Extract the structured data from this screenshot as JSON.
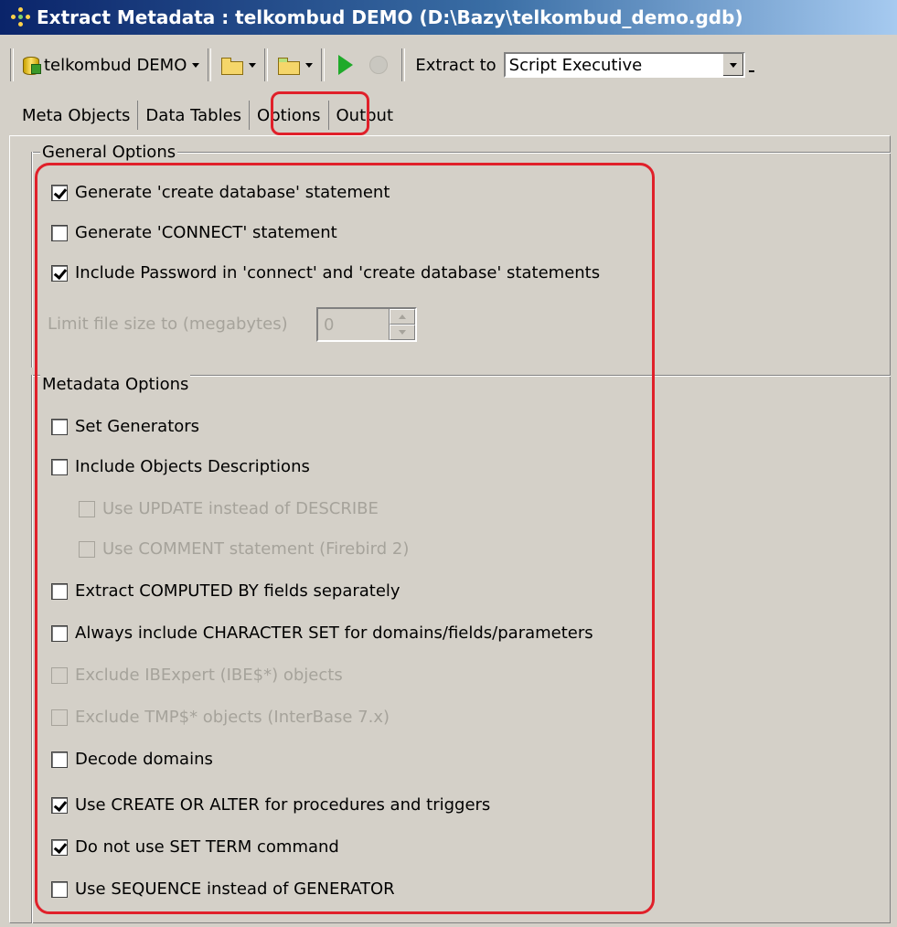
{
  "window": {
    "title": "Extract Metadata : telkombud DEMO (D:\\Bazy\\telkombud_demo.gdb)"
  },
  "toolbar": {
    "database_label": "telkombud DEMO",
    "extract_to_label": "Extract to",
    "extract_to_value": "Script Executive"
  },
  "tabs": [
    {
      "label": "Meta Objects"
    },
    {
      "label": "Data Tables"
    },
    {
      "label": "Options",
      "active": true
    },
    {
      "label": "Output"
    }
  ],
  "general": {
    "title": "General Options",
    "options": [
      {
        "label": "Generate 'create database' statement",
        "checked": true
      },
      {
        "label": "Generate 'CONNECT' statement",
        "checked": false
      },
      {
        "label": "Include Password in 'connect' and 'create database' statements",
        "checked": true
      }
    ],
    "limit_label": "Limit file size to (megabytes)",
    "limit_value": "0"
  },
  "metadata": {
    "title": "Metadata Options",
    "options": [
      {
        "label": "Set Generators",
        "checked": false
      },
      {
        "label": "Include Objects Descriptions",
        "checked": false
      },
      {
        "label": "Use UPDATE instead of DESCRIBE",
        "checked": false,
        "disabled": true
      },
      {
        "label": "Use COMMENT statement (Firebird 2)",
        "checked": false,
        "disabled": true
      },
      {
        "label": "Extract COMPUTED BY fields separately",
        "checked": false
      },
      {
        "label": "Always include CHARACTER SET for domains/fields/parameters",
        "checked": false
      },
      {
        "label": "Exclude IBExpert (IBE$*) objects",
        "checked": false,
        "disabled": true
      },
      {
        "label": "Exclude TMP$* objects (InterBase 7.x)",
        "checked": false,
        "disabled": true
      },
      {
        "label": "Decode domains",
        "checked": false
      },
      {
        "label": "Use CREATE OR ALTER for procedures and triggers",
        "checked": true
      },
      {
        "label": "Do not use SET TERM command",
        "checked": true
      },
      {
        "label": "Use SEQUENCE instead of GENERATOR",
        "checked": false
      }
    ]
  },
  "colors": {
    "title_start": "#0a246a",
    "title_end": "#a6caf0",
    "highlight": "#e0202a",
    "face": "#d4d0c8"
  }
}
